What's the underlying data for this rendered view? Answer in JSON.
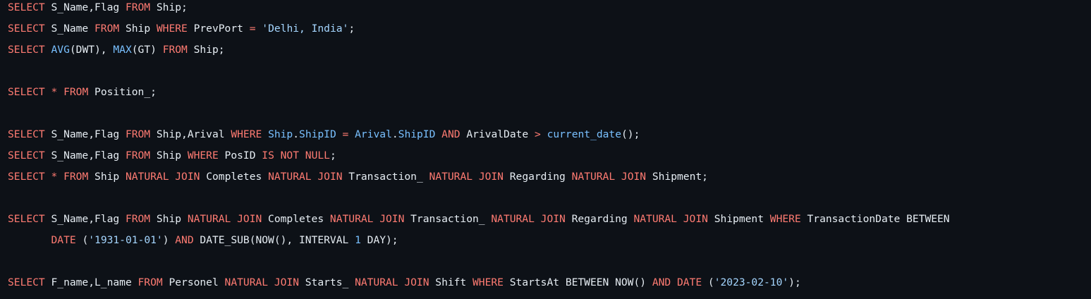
{
  "colors": {
    "background": "#0d1117",
    "text": "#e6edf3",
    "keyword": "#ff7b72",
    "function": "#79c0ff",
    "string": "#a5d6ff"
  },
  "code": {
    "lines": [
      [
        [
          "kw",
          "SELECT"
        ],
        [
          "pl",
          " S_Name,Flag "
        ],
        [
          "kw",
          "FROM"
        ],
        [
          "pl",
          " Ship;"
        ]
      ],
      [
        [
          "kw",
          "SELECT"
        ],
        [
          "pl",
          " S_Name "
        ],
        [
          "kw",
          "FROM"
        ],
        [
          "pl",
          " Ship "
        ],
        [
          "kw",
          "WHERE"
        ],
        [
          "pl",
          " PrevPort "
        ],
        [
          "kw",
          "="
        ],
        [
          "pl",
          " "
        ],
        [
          "str",
          "'Delhi, India'"
        ],
        [
          "pl",
          ";"
        ]
      ],
      [
        [
          "kw",
          "SELECT"
        ],
        [
          "pl",
          " "
        ],
        [
          "fn",
          "AVG"
        ],
        [
          "pl",
          "(DWT), "
        ],
        [
          "fn",
          "MAX"
        ],
        [
          "pl",
          "(GT) "
        ],
        [
          "kw",
          "FROM"
        ],
        [
          "pl",
          " Ship;"
        ]
      ],
      [],
      [
        [
          "kw",
          "SELECT"
        ],
        [
          "pl",
          " "
        ],
        [
          "kw",
          "*"
        ],
        [
          "pl",
          " "
        ],
        [
          "kw",
          "FROM"
        ],
        [
          "pl",
          " Position_;"
        ]
      ],
      [],
      [
        [
          "kw",
          "SELECT"
        ],
        [
          "pl",
          " S_Name,Flag "
        ],
        [
          "kw",
          "FROM"
        ],
        [
          "pl",
          " Ship,Arival "
        ],
        [
          "kw",
          "WHERE"
        ],
        [
          "pl",
          " "
        ],
        [
          "fn",
          "Ship"
        ],
        [
          "pl",
          "."
        ],
        [
          "fn",
          "ShipID"
        ],
        [
          "pl",
          " "
        ],
        [
          "kw",
          "="
        ],
        [
          "pl",
          " "
        ],
        [
          "fn",
          "Arival"
        ],
        [
          "pl",
          "."
        ],
        [
          "fn",
          "ShipID"
        ],
        [
          "pl",
          " "
        ],
        [
          "kw",
          "AND"
        ],
        [
          "pl",
          " ArivalDate "
        ],
        [
          "kw",
          ">"
        ],
        [
          "pl",
          " "
        ],
        [
          "fn",
          "current_date"
        ],
        [
          "pl",
          "();"
        ]
      ],
      [
        [
          "kw",
          "SELECT"
        ],
        [
          "pl",
          " S_Name,Flag "
        ],
        [
          "kw",
          "FROM"
        ],
        [
          "pl",
          " Ship "
        ],
        [
          "kw",
          "WHERE"
        ],
        [
          "pl",
          " PosID "
        ],
        [
          "kw",
          "IS NOT NULL"
        ],
        [
          "pl",
          ";"
        ]
      ],
      [
        [
          "kw",
          "SELECT"
        ],
        [
          "pl",
          " "
        ],
        [
          "kw",
          "*"
        ],
        [
          "pl",
          " "
        ],
        [
          "kw",
          "FROM"
        ],
        [
          "pl",
          " Ship "
        ],
        [
          "kw",
          "NATURAL JOIN"
        ],
        [
          "pl",
          " Completes "
        ],
        [
          "kw",
          "NATURAL JOIN"
        ],
        [
          "pl",
          " Transaction_ "
        ],
        [
          "kw",
          "NATURAL JOIN"
        ],
        [
          "pl",
          " Regarding "
        ],
        [
          "kw",
          "NATURAL JOIN"
        ],
        [
          "pl",
          " Shipment;"
        ]
      ],
      [],
      [
        [
          "kw",
          "SELECT"
        ],
        [
          "pl",
          " S_Name,Flag "
        ],
        [
          "kw",
          "FROM"
        ],
        [
          "pl",
          " Ship "
        ],
        [
          "kw",
          "NATURAL JOIN"
        ],
        [
          "pl",
          " Completes "
        ],
        [
          "kw",
          "NATURAL JOIN"
        ],
        [
          "pl",
          " Transaction_ "
        ],
        [
          "kw",
          "NATURAL JOIN"
        ],
        [
          "pl",
          " Regarding "
        ],
        [
          "kw",
          "NATURAL JOIN"
        ],
        [
          "pl",
          " Shipment "
        ],
        [
          "kw",
          "WHERE"
        ],
        [
          "pl",
          " TransactionDate BETWEEN"
        ]
      ],
      [
        [
          "pl",
          "       "
        ],
        [
          "kw",
          "DATE"
        ],
        [
          "pl",
          " ("
        ],
        [
          "str",
          "'1931-01-01'"
        ],
        [
          "pl",
          ") "
        ],
        [
          "kw",
          "AND"
        ],
        [
          "pl",
          " DATE_SUB(NOW(), INTERVAL "
        ],
        [
          "fn",
          "1"
        ],
        [
          "pl",
          " DAY);"
        ]
      ],
      [],
      [
        [
          "kw",
          "SELECT"
        ],
        [
          "pl",
          " F_name,L_name "
        ],
        [
          "kw",
          "FROM"
        ],
        [
          "pl",
          " Personel "
        ],
        [
          "kw",
          "NATURAL JOIN"
        ],
        [
          "pl",
          " Starts_ "
        ],
        [
          "kw",
          "NATURAL JOIN"
        ],
        [
          "pl",
          " Shift "
        ],
        [
          "kw",
          "WHERE"
        ],
        [
          "pl",
          " StartsAt BETWEEN NOW() "
        ],
        [
          "kw",
          "AND"
        ],
        [
          "pl",
          " "
        ],
        [
          "kw",
          "DATE"
        ],
        [
          "pl",
          " ("
        ],
        [
          "str",
          "'2023-02-10'"
        ],
        [
          "pl",
          ");"
        ]
      ]
    ]
  }
}
